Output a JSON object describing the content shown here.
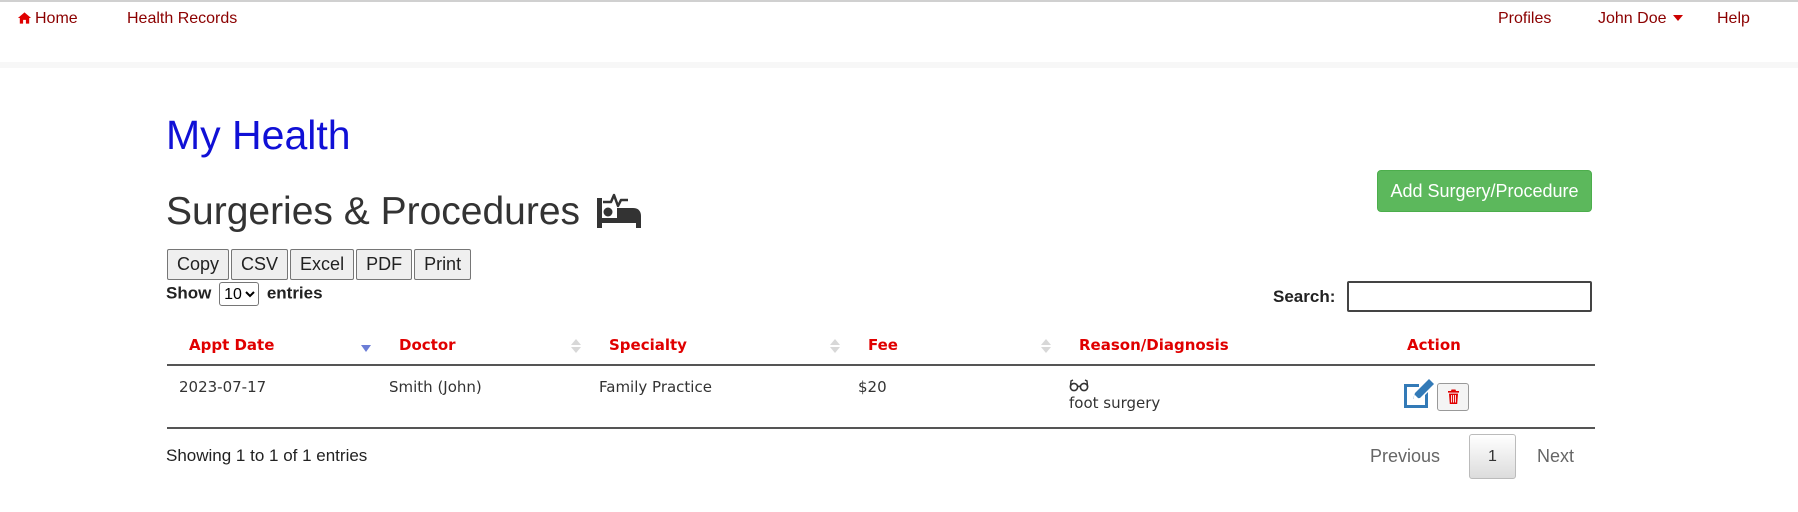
{
  "nav": {
    "home": "Home",
    "records": "Health Records",
    "profiles": "Profiles",
    "user": "John Doe",
    "help": "Help"
  },
  "page_title": "My Health",
  "section_title": "Surgeries & Procedures",
  "add_button": "Add Surgery/Procedure",
  "export_buttons": [
    "Copy",
    "CSV",
    "Excel",
    "PDF",
    "Print"
  ],
  "length": {
    "show": "Show",
    "value": "10",
    "entries": "entries"
  },
  "search": {
    "label": "Search:",
    "value": ""
  },
  "table": {
    "headers": [
      "Appt Date",
      "Doctor",
      "Specialty",
      "Fee",
      "Reason/Diagnosis",
      "Action"
    ],
    "rows": [
      {
        "date": "2023-07-17",
        "doctor": "Smith (John)",
        "specialty": "Family Practice",
        "fee": "$20",
        "reason": "foot surgery"
      }
    ]
  },
  "info": "Showing 1 to 1 of 1 entries",
  "pagination": {
    "previous": "Previous",
    "current": "1",
    "next": "Next"
  },
  "colors": {
    "nav_link": "#8b0000",
    "title": "#1010d6",
    "header_text": "#e00000",
    "add_button": "#5cb85c",
    "edit_icon": "#337ab7",
    "delete_icon": "#e00000"
  }
}
